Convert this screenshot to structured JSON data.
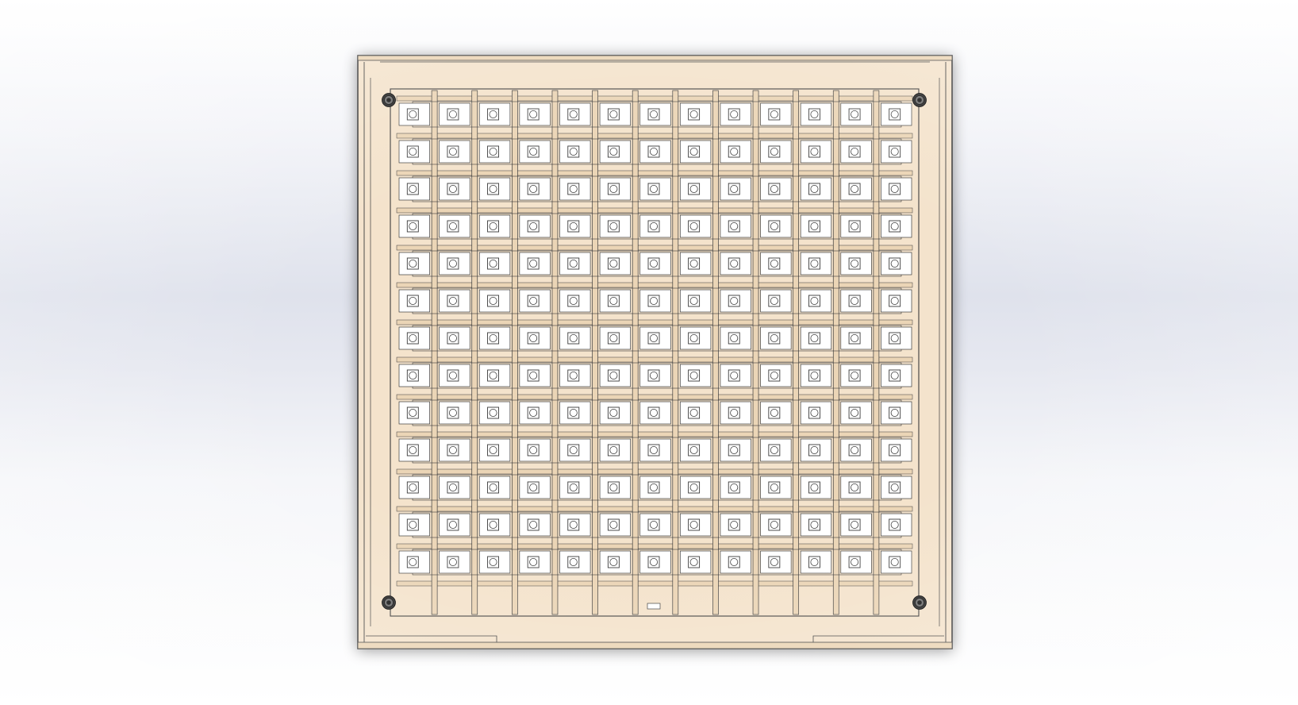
{
  "scene": {
    "model": "square-panel-grid",
    "rows": 13,
    "columns": 13,
    "mount_holes": 4,
    "colors": {
      "background_light": "#ffffff",
      "background_mid": "#dfe2ec",
      "panel_fill": "#f4e3cc",
      "panel_shade": "#ebd5b6",
      "cell_fill": "#ffffff",
      "outline": "#3b3b3b",
      "hole_fill": "#2a2a2a"
    },
    "icons": [
      "mounting-hole-icon",
      "component-pad-icon"
    ]
  }
}
